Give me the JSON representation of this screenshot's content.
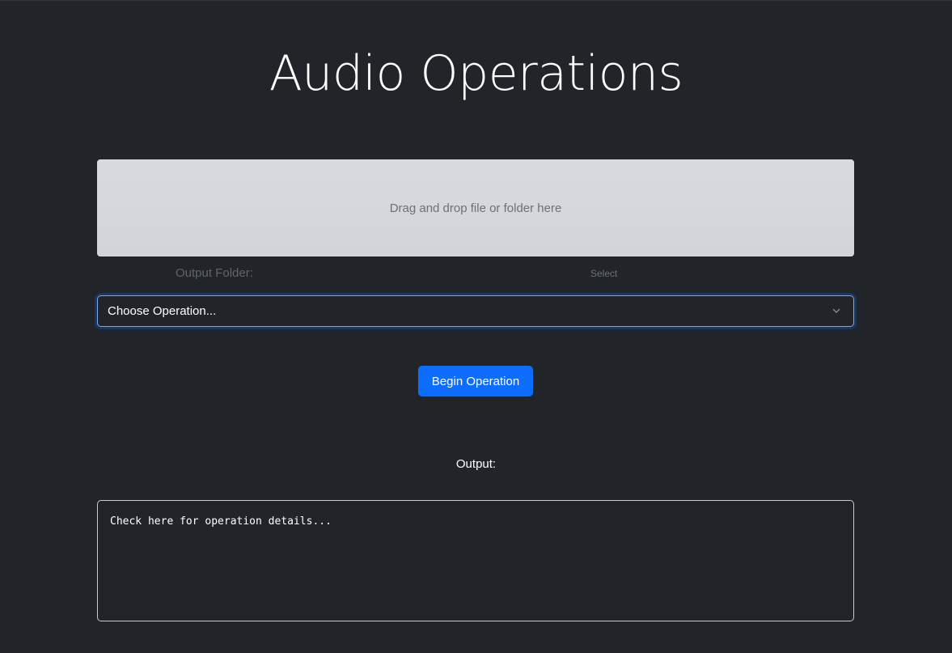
{
  "page": {
    "title": "Audio Operations"
  },
  "dropzone": {
    "text": "Drag and drop file or folder here"
  },
  "output_folder": {
    "label": "Output Folder:",
    "select_label": "Select"
  },
  "operation_select": {
    "selected": "Choose Operation..."
  },
  "actions": {
    "begin_label": "Begin Operation"
  },
  "output": {
    "label": "Output:",
    "placeholder": "Check here for operation details..."
  },
  "colors": {
    "background": "#212529",
    "primary": "#0d6efd",
    "dropzone": "#d6d9dd",
    "focus_border": "#7aa7f0"
  }
}
